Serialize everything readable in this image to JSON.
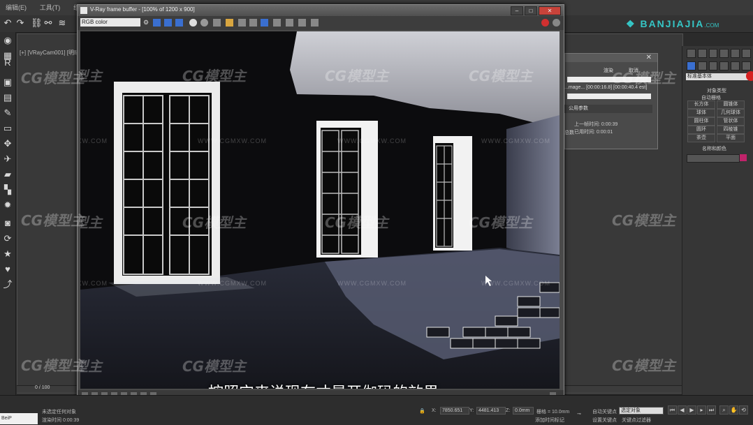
{
  "app": {
    "menu": [
      "编辑(E)",
      "工具(T)",
      "组(G)"
    ],
    "viewport_label": "[+] [VRayCam001] [明暗处理]",
    "brand": {
      "name": "BANJIAJIA",
      "domain": ".COM",
      "color": "#35c6c6"
    }
  },
  "framebuffer": {
    "title": "V-Ray frame buffer - [100% of 1200 x 900]",
    "channel": "RGB color",
    "subtitle": "按照它来说现在才是开伽码的效果"
  },
  "render_dialog": {
    "ok": "渲染",
    "cancel": "取消",
    "file_line": "...mage... [00:00:16.8] [00:00:40.4 est]",
    "section": "公用参数",
    "last_frame": "上一帧时间: 0:00:39",
    "elapsed": "已用时间: 0:00:01",
    "count": "总数"
  },
  "command_panel": {
    "dropdown": "标准基本体",
    "rollout": "对象类型",
    "autogrid": "自动栅格",
    "buttons": [
      "长方体",
      "圆锥体",
      "球体",
      "几何球体",
      "圆柱体",
      "管状体",
      "圆环",
      "四棱锥",
      "茶壶",
      "平面"
    ],
    "name_color": "名称和颜色"
  },
  "watermark": {
    "logo": "CG模型主",
    "url": "WWW.CGMXW.COM"
  },
  "bottom": {
    "slider": "0 / 100",
    "status1": "未选定任何对象",
    "status2": "渲染时间 0:00:39",
    "x_label": "X:",
    "x_value": "7850.651",
    "y_label": "Y:",
    "y_value": "4481.413",
    "z_label": "Z:",
    "z_value": "0.0mm",
    "grid": "栅格 = 10.0mm",
    "auto_key": "自动关键点",
    "set_key": "设置关键点",
    "selected": "选定对象",
    "key_filter": "关键点过滤器",
    "add_tag": "添加时间标记",
    "maxscript": "BeiP"
  }
}
